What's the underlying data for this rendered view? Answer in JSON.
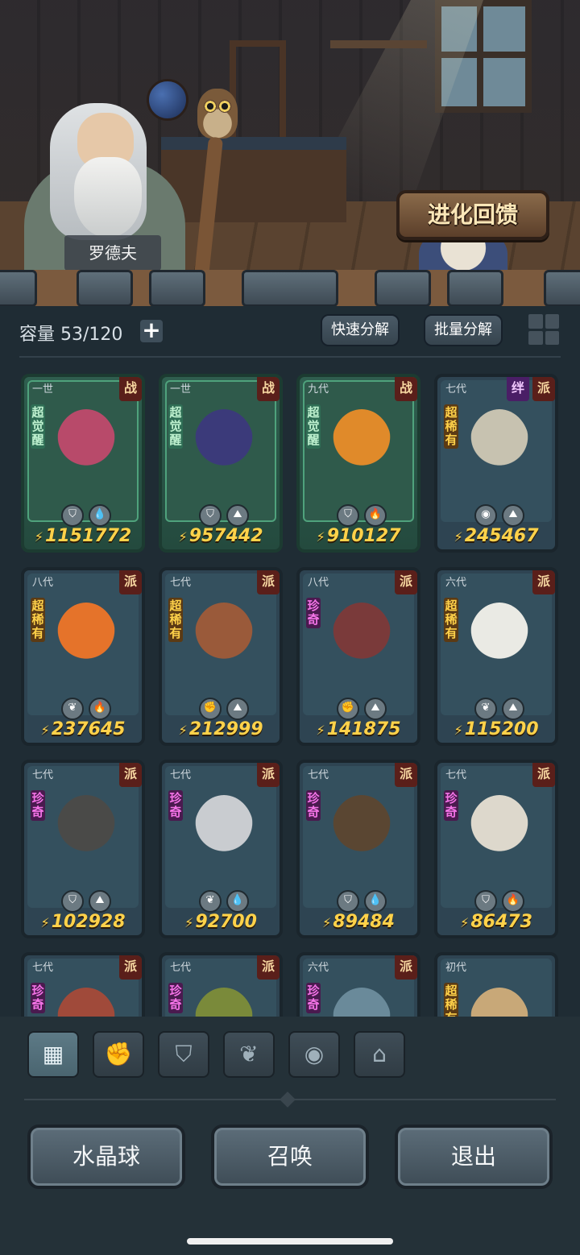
{
  "npc": {
    "name": "罗德夫"
  },
  "evolve_button": "进化回馈",
  "inventory": {
    "capacity": "容量 53/120",
    "add_label": "+",
    "quick_decompose": "快速分解",
    "batch_decompose": "批量分解"
  },
  "cards": [
    {
      "gen": "一世",
      "tags": [
        "战"
      ],
      "rarity": "超觉醒",
      "elements": [
        "盾",
        "滴"
      ],
      "power": "1151772",
      "awake": true,
      "color": "#b84a6a"
    },
    {
      "gen": "一世",
      "tags": [
        "战"
      ],
      "rarity": "超觉醒",
      "elements": [
        "盾",
        "土"
      ],
      "power": "957442",
      "awake": true,
      "color": "#3b3a7a"
    },
    {
      "gen": "九代",
      "tags": [
        "战"
      ],
      "rarity": "超觉醒",
      "elements": [
        "盾",
        "火"
      ],
      "power": "910127",
      "awake": true,
      "color": "#e08a2a"
    },
    {
      "gen": "七代",
      "tags": [
        "派",
        "绊"
      ],
      "rarity": "超稀有",
      "elements": [
        "眼",
        "土"
      ],
      "power": "245467",
      "awake": false,
      "color": "#c7c2b0"
    },
    {
      "gen": "八代",
      "tags": [
        "派"
      ],
      "rarity": "超稀有",
      "elements": [
        "叶",
        "火"
      ],
      "power": "237645",
      "awake": false,
      "color": "#e5732a"
    },
    {
      "gen": "七代",
      "tags": [
        "派"
      ],
      "rarity": "超稀有",
      "elements": [
        "拳",
        "土"
      ],
      "power": "212999",
      "awake": false,
      "color": "#9a5a3a"
    },
    {
      "gen": "八代",
      "tags": [
        "派"
      ],
      "rarity": "珍奇",
      "elements": [
        "拳",
        "土"
      ],
      "power": "141875",
      "awake": false,
      "color": "#7a3a3a"
    },
    {
      "gen": "六代",
      "tags": [
        "派"
      ],
      "rarity": "超稀有",
      "elements": [
        "叶",
        "土"
      ],
      "power": "115200",
      "awake": false,
      "color": "#eaeae4"
    },
    {
      "gen": "七代",
      "tags": [
        "派"
      ],
      "rarity": "珍奇",
      "elements": [
        "盾",
        "土"
      ],
      "power": "102928",
      "awake": false,
      "color": "#4a4a48"
    },
    {
      "gen": "七代",
      "tags": [
        "派"
      ],
      "rarity": "珍奇",
      "elements": [
        "叶",
        "滴"
      ],
      "power": "92700",
      "awake": false,
      "color": "#c9ccd0"
    },
    {
      "gen": "七代",
      "tags": [
        "派"
      ],
      "rarity": "珍奇",
      "elements": [
        "盾",
        "滴"
      ],
      "power": "89484",
      "awake": false,
      "color": "#5a4632"
    },
    {
      "gen": "七代",
      "tags": [
        "派"
      ],
      "rarity": "珍奇",
      "elements": [
        "盾",
        "火"
      ],
      "power": "86473",
      "awake": false,
      "color": "#ddd8cc"
    },
    {
      "gen": "七代",
      "tags": [
        "派"
      ],
      "rarity": "珍奇",
      "elements": [],
      "power": "",
      "awake": false,
      "color": "#a04a3a"
    },
    {
      "gen": "七代",
      "tags": [
        "派"
      ],
      "rarity": "珍奇",
      "elements": [],
      "power": "",
      "awake": false,
      "color": "#7a8a3a"
    },
    {
      "gen": "六代",
      "tags": [
        "派"
      ],
      "rarity": "珍奇",
      "elements": [],
      "power": "",
      "awake": false,
      "color": "#6a8a9a"
    },
    {
      "gen": "初代",
      "tags": [],
      "rarity": "超稀有",
      "elements": [],
      "power": "",
      "awake": false,
      "color": "#c8a878"
    }
  ],
  "filters": [
    {
      "name": "all-icon",
      "glyph": "▦",
      "active": true
    },
    {
      "name": "fist-icon",
      "glyph": "✊",
      "active": false
    },
    {
      "name": "shield-icon",
      "glyph": "⛉",
      "active": false
    },
    {
      "name": "leaf-icon",
      "glyph": "❦",
      "active": false
    },
    {
      "name": "eye-orb-icon",
      "glyph": "◉",
      "active": false
    },
    {
      "name": "shrine-icon",
      "glyph": "⌂",
      "active": false
    }
  ],
  "bottom_buttons": {
    "crystal_ball": "水晶球",
    "summon": "召唤",
    "exit": "退出"
  }
}
